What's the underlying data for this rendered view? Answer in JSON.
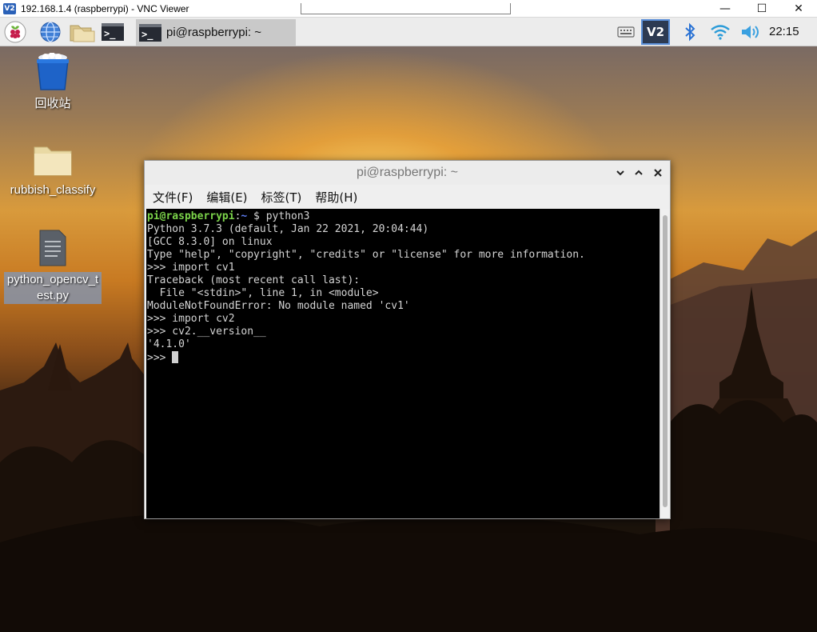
{
  "vnc": {
    "logo_text": "V2",
    "title": "192.168.1.4 (raspberrypi) - VNC Viewer",
    "minimize": "—",
    "maximize": "☐",
    "close": "✕"
  },
  "taskbar": {
    "launchers": [
      {
        "name": "raspberry-menu-icon"
      },
      {
        "name": "web-browser-icon"
      },
      {
        "name": "file-manager-icon"
      },
      {
        "name": "terminal-launcher-icon",
        "glyph": ">_"
      }
    ],
    "task": {
      "glyph": ">_",
      "label": "pi@raspberrypi: ~"
    },
    "tray": {
      "keyboard": "keyboard-icon",
      "vnc_logo": "V2",
      "bluetooth": "bluetooth-icon",
      "wifi": "wifi-icon",
      "volume": "volume-icon"
    },
    "clock": "22:15"
  },
  "desktop": {
    "items": [
      {
        "label": "回收站",
        "icon": "trash-icon"
      },
      {
        "label": "rubbish_classify",
        "icon": "folder-icon"
      },
      {
        "label": "python_opencv_test.py",
        "label_line1": "python_opencv_t",
        "label_line2": "est.py",
        "icon": "text-file-icon"
      }
    ]
  },
  "terminal": {
    "title": "pi@raspberrypi: ~",
    "menu": [
      "文件(F)",
      "编辑(E)",
      "标签(T)",
      "帮助(H)"
    ],
    "prompt_user": "pi@raspberrypi",
    "prompt_sep": ":",
    "prompt_dir": "~",
    "prompt_tail": " $ python3",
    "lines": [
      "Python 3.7.3 (default, Jan 22 2021, 20:04:44)",
      "[GCC 8.3.0] on linux",
      "Type \"help\", \"copyright\", \"credits\" or \"license\" for more information.",
      ">>> import cv1",
      "Traceback (most recent call last):",
      "  File \"<stdin>\", line 1, in <module>",
      "ModuleNotFoundError: No module named 'cv1'",
      ">>> import cv2",
      ">>> cv2.__version__",
      "'4.1.0'"
    ],
    "current_prompt": ">>> "
  },
  "colors": {
    "prompt_user": "#7bd34a",
    "prompt_dir": "#5d7cf0",
    "terminal_bg": "#000000",
    "terminal_fg": "#d4d4d4",
    "vnc_accent": "#2a61b8"
  }
}
